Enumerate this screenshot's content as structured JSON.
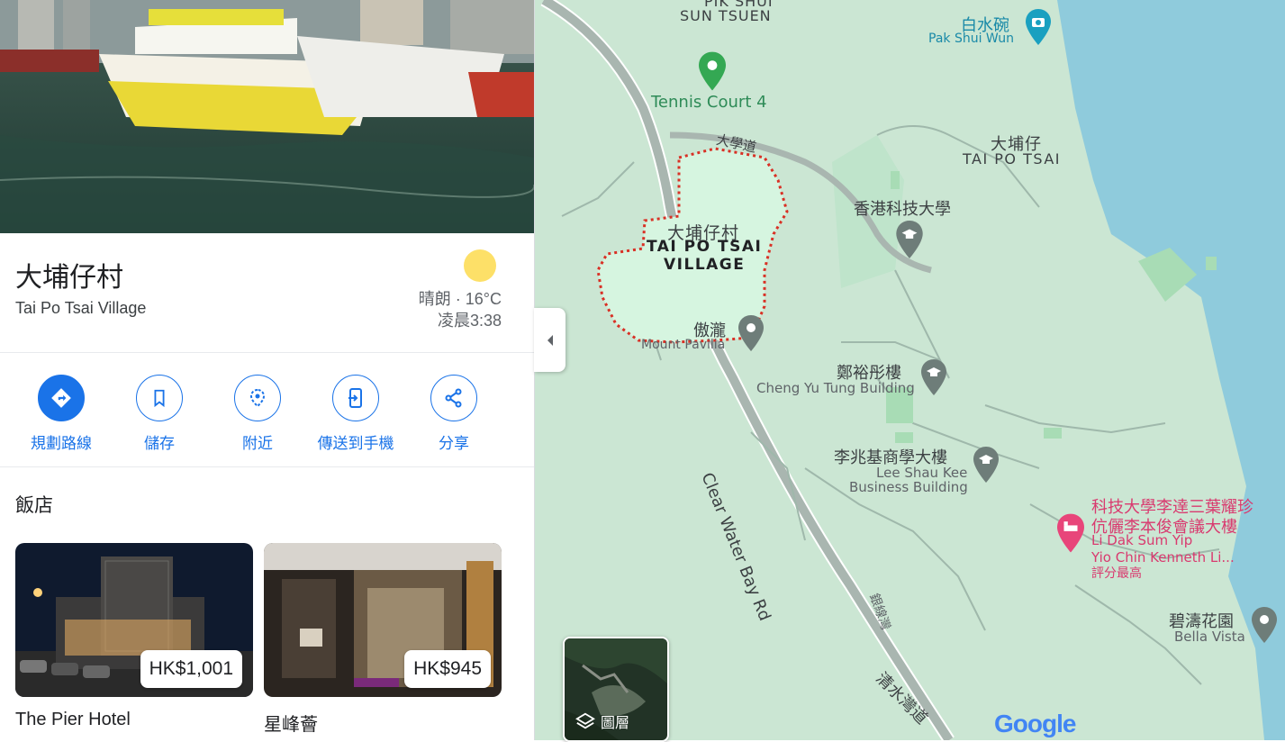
{
  "place": {
    "name": "大埔仔村",
    "subtitle": "Tai Po Tsai Village",
    "weather_line1": "晴朗 · 16°C",
    "weather_line2": "凌晨3:38"
  },
  "actions": [
    {
      "label": "規劃路線",
      "icon": "directions-icon"
    },
    {
      "label": "儲存",
      "icon": "bookmark-icon"
    },
    {
      "label": "附近",
      "icon": "nearby-icon"
    },
    {
      "label": "傳送到手機",
      "icon": "send-to-phone-icon"
    },
    {
      "label": "分享",
      "icon": "share-icon"
    }
  ],
  "hotels": {
    "heading": "飯店",
    "items": [
      {
        "name": "The Pier Hotel",
        "price": "HK$1,001"
      },
      {
        "name": "星峰薈",
        "price": "HK$945"
      }
    ]
  },
  "map": {
    "labels": {
      "pik_shui": "PIK SHUI",
      "sun_tsuen": "SUN TSUEN",
      "pak_shui_wun_zh": "白水碗",
      "pak_shui_wun_en": "Pak Shui Wun",
      "tennis": "Tennis Court 4",
      "university_rd": "大學道",
      "tai_po_tsai_zh": "大埔仔",
      "tai_po_tsai_en": "TAI PO TSAI",
      "hkust": "香港科技大學",
      "village_zh": "大埔仔村",
      "village_en1": "TAI PO TSAI",
      "village_en2": "VILLAGE",
      "mount_pavilia_zh": "傲瀧",
      "mount_pavilia_en": "Mount Pavilia",
      "cheng_yu_tung_zh": "鄭裕彤樓",
      "cheng_yu_tung_en": "Cheng Yu Tung Building",
      "clear_water_bay_rd": "Clear Water Bay Rd",
      "lee_shau_kee_zh": "李兆基商學大樓",
      "lee_shau_kee_en1": "Lee Shau Kee",
      "lee_shau_kee_en2": "Business Building",
      "hotel_zh1": "科技大學李達三葉耀珍",
      "hotel_zh2": "伉儷李本俊會議大樓",
      "hotel_en1": "Li Dak Sum Yip",
      "hotel_en2": "Yio Chin Kenneth Li...",
      "hotel_rating": "評分最高",
      "side_road": "銀線灣",
      "cwb_rd_zh": "清水灣道",
      "bella_vista_zh": "碧濤花園",
      "bella_vista_en": "Bella Vista"
    },
    "layers_label": "圖層",
    "logo": "Google"
  },
  "colors": {
    "accent": "#1a73e8",
    "map_land": "#cbe6d3",
    "water": "#8fcbdc",
    "route_outline": "#d93025",
    "hotel_pin": "#e8457a"
  }
}
